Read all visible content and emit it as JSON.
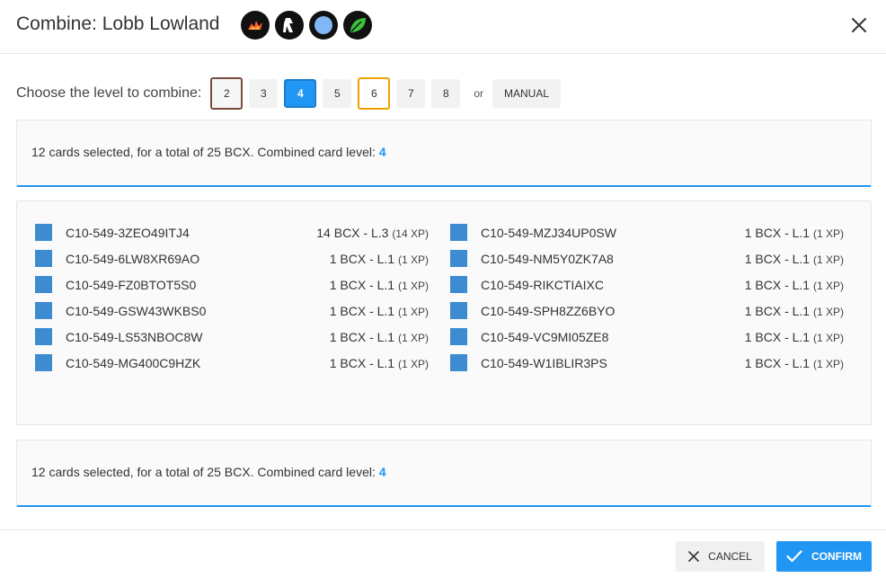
{
  "header": {
    "title": "Combine: Lobb Lowland",
    "badges": [
      {
        "icon": "fire-element-icon",
        "color": "#ff5a2a"
      },
      {
        "icon": "running-figure-icon",
        "color": "#ffffff"
      },
      {
        "icon": "water-circle-icon",
        "color": "#7fb8f5"
      },
      {
        "icon": "leaf-icon",
        "color": "#3cc23c"
      }
    ]
  },
  "level_selector": {
    "label": "Choose the level to combine:",
    "levels": [
      "2",
      "3",
      "4",
      "5",
      "6",
      "7",
      "8"
    ],
    "selected": "4",
    "or_label": "or",
    "manual_label": "MANUAL"
  },
  "summary": {
    "text": "12 cards selected, for a total of 25 BCX. Combined card level:",
    "level": "4"
  },
  "cards": {
    "left": [
      {
        "id": "C10-549-3ZEO49ITJ4",
        "value": "14 BCX - L.3",
        "xp": "(14 XP)"
      },
      {
        "id": "C10-549-6LW8XR69AO",
        "value": "1 BCX - L.1",
        "xp": "(1 XP)"
      },
      {
        "id": "C10-549-FZ0BTOT5S0",
        "value": "1 BCX - L.1",
        "xp": "(1 XP)"
      },
      {
        "id": "C10-549-GSW43WKBS0",
        "value": "1 BCX - L.1",
        "xp": "(1 XP)"
      },
      {
        "id": "C10-549-LS53NBOC8W",
        "value": "1 BCX - L.1",
        "xp": "(1 XP)"
      },
      {
        "id": "C10-549-MG400C9HZK",
        "value": "1 BCX - L.1",
        "xp": "(1 XP)"
      }
    ],
    "right": [
      {
        "id": "C10-549-MZJ34UP0SW",
        "value": "1 BCX - L.1",
        "xp": "(1 XP)"
      },
      {
        "id": "C10-549-NM5Y0ZK7A8",
        "value": "1 BCX - L.1",
        "xp": "(1 XP)"
      },
      {
        "id": "C10-549-RIKCTIAIXC",
        "value": "1 BCX - L.1",
        "xp": "(1 XP)"
      },
      {
        "id": "C10-549-SPH8ZZ6BYO",
        "value": "1 BCX - L.1",
        "xp": "(1 XP)"
      },
      {
        "id": "C10-549-VC9MI05ZE8",
        "value": "1 BCX - L.1",
        "xp": "(1 XP)"
      },
      {
        "id": "C10-549-W1IBLIR3PS",
        "value": "1 BCX - L.1",
        "xp": "(1 XP)"
      }
    ]
  },
  "footer": {
    "cancel_label": "CANCEL",
    "confirm_label": "CONFIRM"
  },
  "colors": {
    "accent": "#2196f3",
    "checkbox": "#3d8bd1",
    "selected_brown": "#7b4a3e",
    "selected_orange": "#f0a000"
  }
}
